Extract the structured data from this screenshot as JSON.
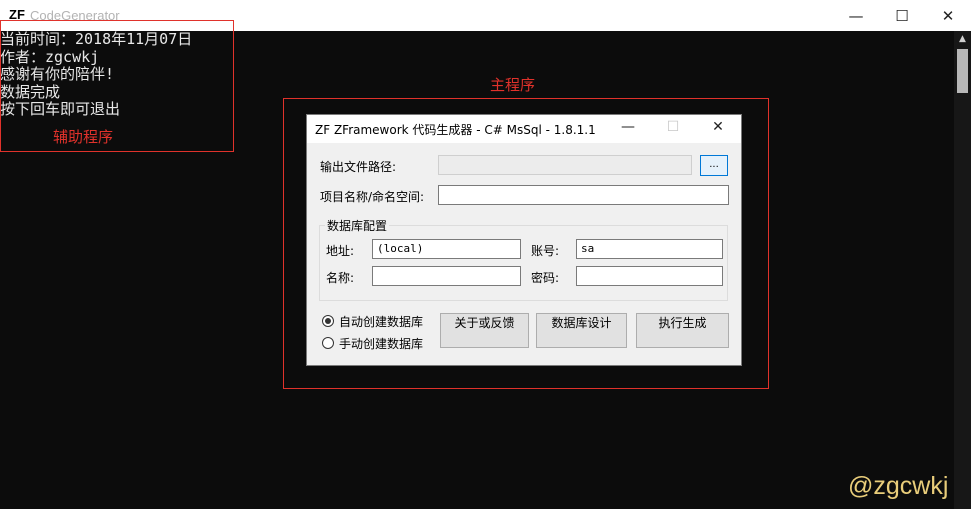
{
  "window": {
    "icon_text": "ZF",
    "title": "CodeGenerator",
    "minimize_glyph": "—",
    "maximize_glyph": "☐",
    "close_glyph": "✕"
  },
  "console": {
    "lines": [
      "当前时间：2018年11月07日",
      "作者：zgcwkj",
      "感谢有你的陪伴!",
      "数据完成",
      "按下回车即可退出"
    ]
  },
  "annotations": {
    "helper_label": "辅助程序",
    "main_label": "主程序",
    "color": "#e0322b"
  },
  "dialog": {
    "title": "ZF  ZFramework 代码生成器 - C# MsSql - 1.8.1.1",
    "output_path_label": "输出文件路径:",
    "output_path_value": "",
    "browse_label": "...",
    "project_label": "项目名称/命名空间:",
    "project_value": "",
    "db_group_label": "数据库配置",
    "address_label": "地址:",
    "address_value": "(local)",
    "account_label": "账号:",
    "account_value": "sa",
    "name_label": "名称:",
    "name_value": "",
    "password_label": "密码:",
    "password_value": "",
    "radio_auto_label": "自动创建数据库",
    "radio_manual_label": "手动创建数据库",
    "selected_radio": "auto",
    "about_button": "关于或反馈",
    "db_design_button": "数据库设计",
    "execute_button": "执行生成"
  },
  "watermark": "@zgcwkj"
}
